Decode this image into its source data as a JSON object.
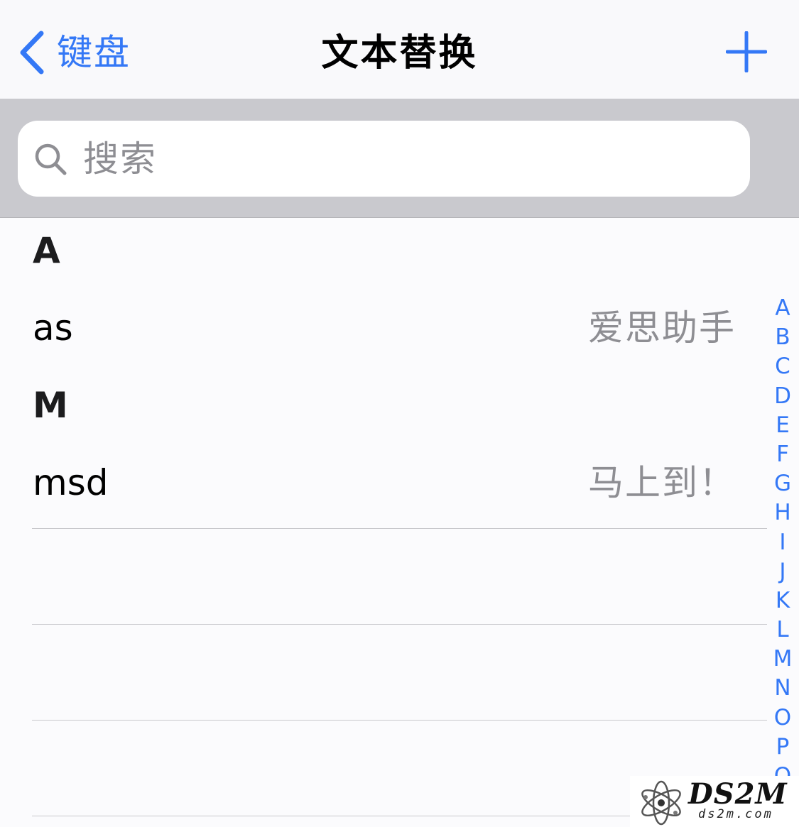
{
  "nav": {
    "back_label": "键盘",
    "title": "文本替换",
    "add_icon": "plus-icon",
    "back_icon": "chevron-left-icon"
  },
  "search": {
    "placeholder": "搜索",
    "value": "",
    "icon": "search-icon"
  },
  "sections": [
    {
      "header": "A",
      "rows": [
        {
          "shortcut": "as",
          "phrase": "爱思助手"
        }
      ]
    },
    {
      "header": "M",
      "rows": [
        {
          "shortcut": "msd",
          "phrase": "马上到！"
        }
      ]
    }
  ],
  "index_letters": [
    "A",
    "B",
    "C",
    "D",
    "E",
    "F",
    "G",
    "H",
    "I",
    "J",
    "K",
    "L",
    "M",
    "N",
    "O",
    "P",
    "Q"
  ],
  "watermark": {
    "title": "DS2M",
    "subtitle": "ds2m.com"
  },
  "colors": {
    "accent": "#3478f6",
    "secondary_text": "#8e8e93",
    "search_background": "#c9c9ce"
  }
}
